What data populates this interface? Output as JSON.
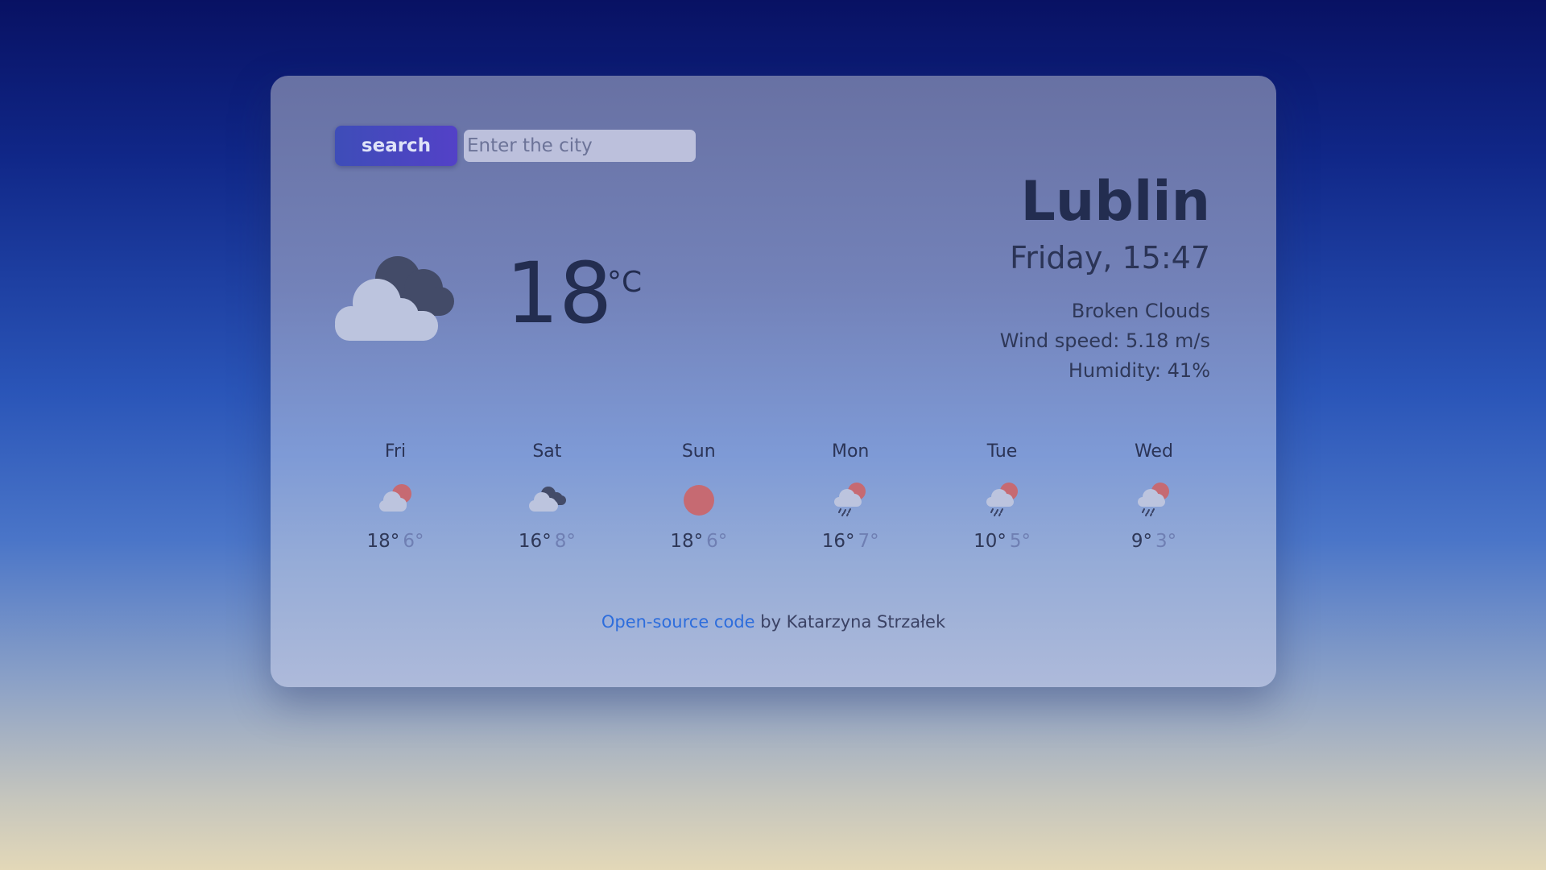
{
  "search": {
    "button_label": "search",
    "placeholder": "Enter the city",
    "value": ""
  },
  "current": {
    "icon": "broken-clouds-icon",
    "temperature": "18",
    "unit": "°C",
    "city": "Lublin",
    "datetime": "Friday, 15:47",
    "description": "Broken Clouds",
    "wind": "Wind speed: 5.18 m/s",
    "humidity": "Humidity: 41%"
  },
  "forecast": [
    {
      "day": "Fri",
      "icon": "few-clouds-icon",
      "max": "18°",
      "min": "6°"
    },
    {
      "day": "Sat",
      "icon": "broken-clouds-icon",
      "max": "16°",
      "min": "8°"
    },
    {
      "day": "Sun",
      "icon": "clear-sun-icon",
      "max": "18°",
      "min": "6°"
    },
    {
      "day": "Mon",
      "icon": "rain-icon",
      "max": "16°",
      "min": "7°"
    },
    {
      "day": "Tue",
      "icon": "rain-icon",
      "max": "10°",
      "min": "5°"
    },
    {
      "day": "Wed",
      "icon": "rain-icon",
      "max": "9°",
      "min": "3°"
    }
  ],
  "footer": {
    "link_text": "Open-source code",
    "byline": " by Katarzyna Strzałek"
  },
  "colors": {
    "sun": "#c66a72",
    "cloud_light": "#bcc4de",
    "cloud_dark": "#434b68",
    "link": "#2d6ddc",
    "button_start": "#3e4db8",
    "button_end": "#5341c7"
  }
}
